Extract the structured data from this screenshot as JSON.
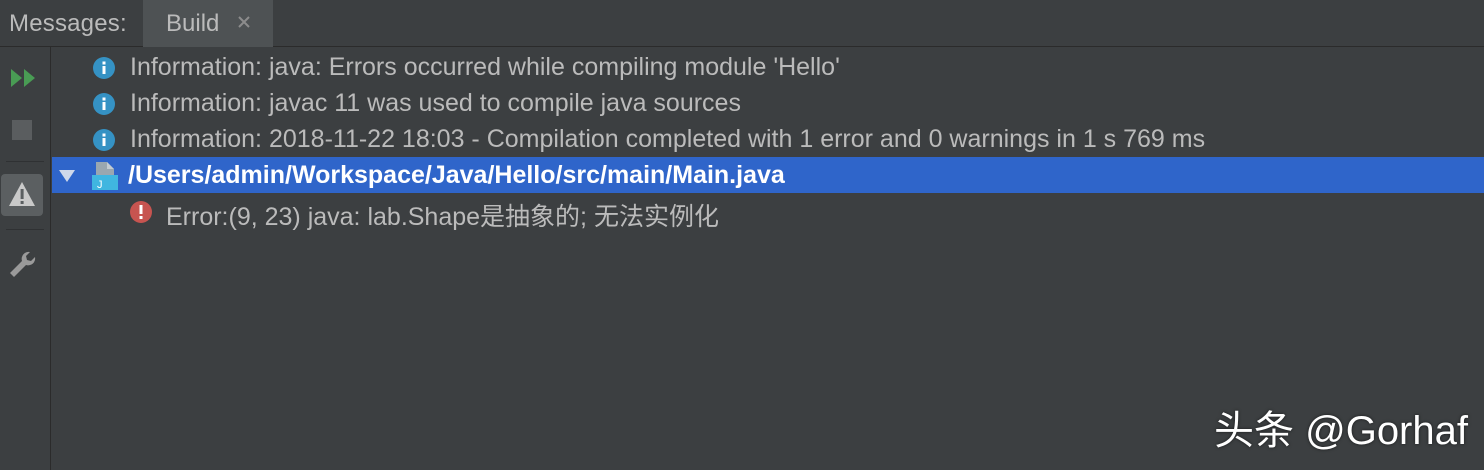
{
  "header": {
    "title": "Messages:",
    "tabs": [
      {
        "label": "Build",
        "close_icon": "close-icon",
        "active": true
      }
    ]
  },
  "toolbar": {
    "items": [
      {
        "icon": "rerun-icon",
        "color": "#499c54"
      },
      {
        "icon": "stop-icon"
      },
      {
        "icon": "warning-icon",
        "active": true
      },
      {
        "icon": "wrench-icon"
      }
    ]
  },
  "messages": [
    {
      "type": "information",
      "icon": "info-icon",
      "text": "Information: java: Errors occurred while compiling module 'Hello'"
    },
    {
      "type": "information",
      "icon": "info-icon",
      "text": "Information: javac 11 was used to compile java sources"
    },
    {
      "type": "information",
      "icon": "info-icon",
      "text": "Information: 2018-11-22 18:03 - Compilation completed with 1 error and 0 warnings in 1 s 769 ms"
    },
    {
      "type": "file",
      "icon": "java-file-icon",
      "expanded": true,
      "selected": true,
      "text": "/Users/admin/Workspace/Java/Hello/src/main/Main.java",
      "children": [
        {
          "type": "error",
          "icon": "error-icon",
          "text": "Error:(9, 23)  java: lab.Shape是抽象的; 无法实例化"
        }
      ]
    }
  ],
  "watermark": "头条 @Gorhaf",
  "colors": {
    "background": "#3c3f41",
    "selection": "#2f65ca",
    "info": "#3592c4",
    "error": "#c75450",
    "run": "#499c54",
    "text": "#bbbbbb"
  }
}
